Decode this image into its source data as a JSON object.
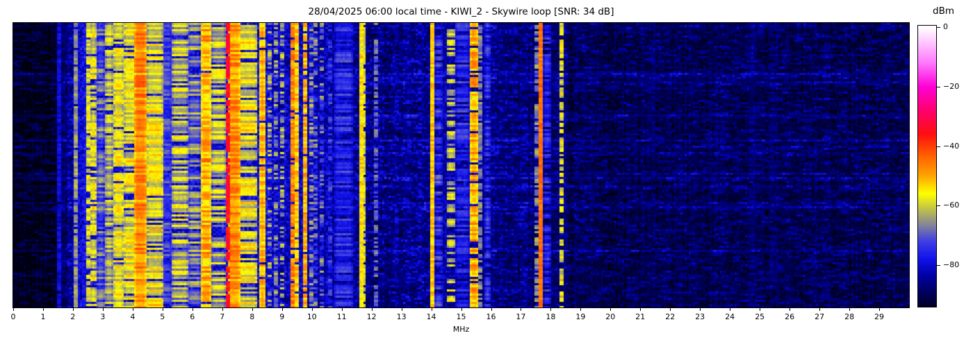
{
  "chart_data": {
    "type": "heatmap",
    "subtype": "radio-spectrogram",
    "title": "28/04/2025 06:00 local time - KIWI_2 - Skywire loop [SNR: 34 dB]",
    "xlabel": "MHz",
    "x_range": [
      0,
      30
    ],
    "x_ticks": [
      "0",
      "1",
      "2",
      "3",
      "4",
      "5",
      "6",
      "7",
      "8",
      "9",
      "10",
      "11",
      "12",
      "13",
      "14",
      "15",
      "16",
      "17",
      "18",
      "19",
      "20",
      "21",
      "22",
      "23",
      "24",
      "25",
      "26",
      "27",
      "28",
      "29"
    ],
    "y_axis": {
      "meaning": "time",
      "ticks_shown": false
    },
    "grid": false,
    "colorbar": {
      "label": "dBm",
      "ticks": [
        {
          "label": "0",
          "value": 0
        },
        {
          "label": "−20",
          "value": -20
        },
        {
          "label": "−40",
          "value": -40
        },
        {
          "label": "−60",
          "value": -60
        },
        {
          "label": "−80",
          "value": -80
        }
      ],
      "vmax": 0.5,
      "vmin": -94
    },
    "colormap_stops": [
      [
        0,
        [
          255,
          255,
          255
        ]
      ],
      [
        -5,
        [
          255,
          200,
          255
        ]
      ],
      [
        -12,
        [
          255,
          120,
          255
        ]
      ],
      [
        -20,
        [
          255,
          0,
          215
        ]
      ],
      [
        -28,
        [
          255,
          0,
          110
        ]
      ],
      [
        -36,
        [
          255,
          15,
          15
        ]
      ],
      [
        -43,
        [
          255,
          95,
          0
        ]
      ],
      [
        -50,
        [
          255,
          165,
          0
        ]
      ],
      [
        -56,
        [
          255,
          255,
          0
        ]
      ],
      [
        -62,
        [
          184,
          184,
          88
        ]
      ],
      [
        -67,
        [
          128,
          128,
          160
        ]
      ],
      [
        -72,
        [
          64,
          64,
          230
        ]
      ],
      [
        -78,
        [
          18,
          18,
          235
        ]
      ],
      [
        -84,
        [
          0,
          0,
          160
        ]
      ],
      [
        -90,
        [
          0,
          0,
          85
        ]
      ],
      [
        -97,
        [
          0,
          0,
          8
        ]
      ]
    ],
    "noise_floor_profile_mhz_dbm": [
      [
        0,
        -96
      ],
      [
        1.45,
        -96
      ],
      [
        1.6,
        -93
      ],
      [
        2.1,
        -82
      ],
      [
        2.6,
        -80
      ],
      [
        7.5,
        -80
      ],
      [
        8.6,
        -81
      ],
      [
        9.5,
        -82
      ],
      [
        11.2,
        -84
      ],
      [
        11.9,
        -88
      ],
      [
        13.8,
        -88
      ],
      [
        14.1,
        -85
      ],
      [
        15.9,
        -86
      ],
      [
        16.3,
        -89
      ],
      [
        18.4,
        -89
      ],
      [
        18.7,
        -92
      ],
      [
        21,
        -92
      ],
      [
        24,
        -91.5
      ],
      [
        26,
        -91.5
      ],
      [
        30,
        -92
      ]
    ],
    "noise_speckle_profile_mhz_db": [
      [
        0,
        2
      ],
      [
        1.5,
        3
      ],
      [
        2.1,
        6
      ],
      [
        8.6,
        6
      ],
      [
        11.5,
        5
      ],
      [
        14,
        5
      ],
      [
        16.3,
        4
      ],
      [
        18.7,
        3.5
      ],
      [
        30,
        3.5
      ]
    ],
    "signal_bands_mhz": [
      {
        "f0": 1.5,
        "f1": 1.56,
        "level": -77,
        "var": 3,
        "duty": 0.95
      },
      {
        "f0": 1.63,
        "f1": 1.68,
        "level": -84,
        "var": 3,
        "duty": 0.6
      },
      {
        "f0": 2.03,
        "f1": 2.1,
        "level": -62,
        "var": 4,
        "duty": 0.9
      },
      {
        "f0": 2.18,
        "f1": 2.25,
        "level": -79,
        "var": 4,
        "duty": 0.7
      },
      {
        "f0": 2.31,
        "f1": 2.38,
        "level": -77,
        "var": 4,
        "duty": 0.7
      },
      {
        "f0": 2.47,
        "f1": 2.57,
        "level": -56,
        "var": 5,
        "duty": 0.85
      },
      {
        "f0": 2.63,
        "f1": 2.74,
        "level": -58,
        "var": 6,
        "duty": 0.75
      },
      {
        "f0": 2.82,
        "f1": 3.02,
        "level": -70,
        "var": 8,
        "duty": 0.9
      },
      {
        "f0": 3.1,
        "f1": 3.34,
        "level": -62,
        "var": 7,
        "duty": 0.9
      },
      {
        "f0": 3.36,
        "f1": 3.66,
        "level": -57,
        "var": 6,
        "duty": 0.9
      },
      {
        "f0": 3.72,
        "f1": 4.06,
        "level": -58,
        "var": 7,
        "duty": 0.9
      },
      {
        "f0": 4.1,
        "f1": 4.46,
        "level": -47,
        "var": 6,
        "duty": 1.0
      },
      {
        "f0": 4.52,
        "f1": 4.96,
        "level": -57,
        "var": 7,
        "duty": 0.9
      },
      {
        "f0": 5.02,
        "f1": 5.3,
        "level": -73,
        "var": 6,
        "duty": 0.9
      },
      {
        "f0": 5.32,
        "f1": 5.82,
        "level": -62,
        "var": 8,
        "duty": 0.8
      },
      {
        "f0": 5.88,
        "f1": 6.26,
        "level": -67,
        "var": 8,
        "duty": 0.8
      },
      {
        "f0": 6.3,
        "f1": 6.62,
        "level": -50,
        "var": 7,
        "duty": 0.95
      },
      {
        "f0": 6.66,
        "f1": 7.1,
        "level": -62,
        "var": 8,
        "duty": 0.8
      },
      {
        "f0": 7.14,
        "f1": 7.2,
        "level": -32,
        "var": 4,
        "duty": 0.85
      },
      {
        "f0": 7.24,
        "f1": 7.56,
        "level": -48,
        "var": 6,
        "duty": 1.0
      },
      {
        "f0": 7.6,
        "f1": 8.12,
        "level": -58,
        "var": 7,
        "duty": 0.8
      },
      {
        "f0": 8.24,
        "f1": 8.4,
        "level": -50,
        "var": 5,
        "duty": 0.95
      },
      {
        "f0": 8.56,
        "f1": 8.64,
        "level": -61,
        "var": 6,
        "duty": 0.5
      },
      {
        "f0": 8.76,
        "f1": 8.84,
        "level": -63,
        "var": 6,
        "duty": 0.5
      },
      {
        "f0": 8.96,
        "f1": 9.04,
        "level": -61,
        "var": 6,
        "duty": 0.5
      },
      {
        "f0": 9.31,
        "f1": 9.37,
        "level": -44,
        "var": 5,
        "duty": 0.9
      },
      {
        "f0": 9.48,
        "f1": 9.55,
        "level": -50,
        "var": 5,
        "duty": 0.9
      },
      {
        "f0": 9.76,
        "f1": 9.83,
        "level": -48,
        "var": 5,
        "duty": 0.9
      },
      {
        "f0": 9.92,
        "f1": 10.0,
        "level": -64,
        "var": 7,
        "duty": 0.55
      },
      {
        "f0": 10.1,
        "f1": 10.18,
        "level": -66,
        "var": 7,
        "duty": 0.5
      },
      {
        "f0": 10.28,
        "f1": 10.36,
        "level": -66,
        "var": 7,
        "duty": 0.5
      },
      {
        "f0": 10.55,
        "f1": 10.62,
        "level": -72,
        "var": 6,
        "duty": 0.6
      },
      {
        "f0": 10.8,
        "f1": 11.35,
        "level": -76,
        "var": 6,
        "duty": 0.8
      },
      {
        "f0": 11.59,
        "f1": 11.66,
        "level": -52,
        "var": 4,
        "duty": 1.0
      },
      {
        "f0": 11.72,
        "f1": 11.79,
        "level": -56,
        "var": 4,
        "duty": 0.85
      },
      {
        "f0": 12.13,
        "f1": 12.19,
        "level": -66,
        "var": 4,
        "duty": 0.6
      },
      {
        "f0": 12.79,
        "f1": 12.85,
        "level": -80,
        "var": 4,
        "duty": 0.4
      },
      {
        "f0": 13.24,
        "f1": 13.3,
        "level": -80,
        "var": 4,
        "duty": 0.4
      },
      {
        "f0": 13.59,
        "f1": 13.65,
        "level": -78,
        "var": 4,
        "duty": 0.5
      },
      {
        "f0": 13.96,
        "f1": 14.04,
        "level": -50,
        "var": 4,
        "duty": 1.0
      },
      {
        "f0": 14.16,
        "f1": 14.36,
        "level": -74,
        "var": 6,
        "duty": 0.7
      },
      {
        "f0": 14.58,
        "f1": 14.74,
        "level": -60,
        "var": 6,
        "duty": 0.5
      },
      {
        "f0": 14.82,
        "f1": 15.24,
        "level": -76,
        "var": 6,
        "duty": 0.7
      },
      {
        "f0": 15.3,
        "f1": 15.52,
        "level": -50,
        "var": 6,
        "duty": 0.9
      },
      {
        "f0": 15.58,
        "f1": 15.65,
        "level": -64,
        "var": 4,
        "duty": 0.7
      },
      {
        "f0": 15.77,
        "f1": 15.94,
        "level": -74,
        "var": 5,
        "duty": 0.75
      },
      {
        "f0": 16.27,
        "f1": 16.35,
        "level": -82,
        "var": 4,
        "duty": 0.5
      },
      {
        "f0": 16.79,
        "f1": 16.87,
        "level": -82,
        "var": 4,
        "duty": 0.5
      },
      {
        "f0": 17.09,
        "f1": 17.17,
        "level": -83,
        "var": 4,
        "duty": 0.4
      },
      {
        "f0": 17.46,
        "f1": 17.57,
        "level": -64,
        "var": 5,
        "duty": 0.6
      },
      {
        "f0": 17.61,
        "f1": 17.69,
        "level": -42,
        "var": 3,
        "duty": 1.0
      },
      {
        "f0": 17.79,
        "f1": 17.95,
        "level": -76,
        "var": 5,
        "duty": 0.8
      },
      {
        "f0": 18.29,
        "f1": 18.41,
        "level": -55,
        "var": 5,
        "duty": 0.7
      },
      {
        "f0": 18.79,
        "f1": 18.86,
        "level": -84,
        "var": 4,
        "duty": 0.4
      },
      {
        "f0": 19.39,
        "f1": 19.46,
        "level": -86,
        "var": 3,
        "duty": 0.35
      },
      {
        "f0": 21.0,
        "f1": 21.1,
        "level": -86,
        "var": 4,
        "duty": 0.4
      },
      {
        "f0": 21.4,
        "f1": 21.47,
        "level": -85,
        "var": 3,
        "duty": 0.4
      },
      {
        "f0": 24.6,
        "f1": 24.9,
        "level": -88,
        "var": 3,
        "duty": 0.6
      },
      {
        "f0": 25.3,
        "f1": 25.6,
        "level": -88,
        "var": 3,
        "duty": 0.6
      }
    ],
    "time_streak_rows": 16
  }
}
